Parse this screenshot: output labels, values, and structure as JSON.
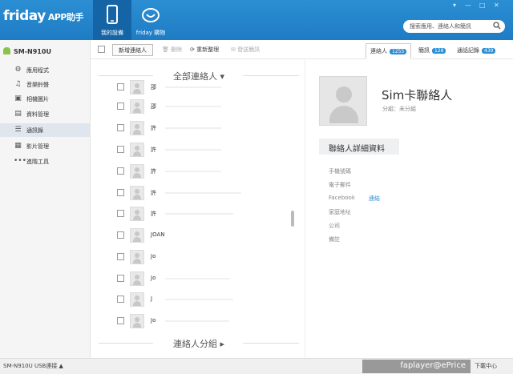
{
  "app": {
    "logo": "friday",
    "logo_sub": "APP助手"
  },
  "nav": [
    {
      "label": "我的設備",
      "icon": "phone-icon"
    },
    {
      "label": "friday 購物",
      "icon": "friday-shop-icon"
    }
  ],
  "window": {
    "menu": "▾",
    "minimize": "—",
    "maximize": "□",
    "close": "✕"
  },
  "search": {
    "placeholder": "搜索應用、連絡人和簡訊"
  },
  "sidebar": {
    "device": "SM-N910U",
    "items": [
      {
        "label": "應用程式",
        "icon": "gear-icon"
      },
      {
        "label": "音樂鈴聲",
        "icon": "music-icon"
      },
      {
        "label": "相機圖片",
        "icon": "image-icon"
      },
      {
        "label": "資料管理",
        "icon": "folder-icon"
      },
      {
        "label": "通訊錄",
        "icon": "contacts-icon"
      },
      {
        "label": "影片管理",
        "icon": "film-icon"
      },
      {
        "label": "進階工具",
        "icon": "more-icon"
      }
    ]
  },
  "toolbar": {
    "add": "新增連絡人",
    "delete": "刪除",
    "refresh": "重新整理",
    "send_sms": "發送簡訊"
  },
  "tabs": [
    {
      "label": "連絡人",
      "count": "1255"
    },
    {
      "label": "簡訊",
      "count": "128"
    },
    {
      "label": "通話記錄",
      "count": "439"
    }
  ],
  "contacts": {
    "group_all": "全部連絡人",
    "group_groups": "連絡人分組",
    "rows": [
      "邵",
      "許",
      "許",
      "許",
      "許",
      "許",
      "許",
      "JOAN",
      "Jo",
      "Jo",
      "J",
      "Jo",
      "Jo"
    ]
  },
  "detail": {
    "name": "Sim卡聯絡人",
    "group_label": "分組：",
    "group_value": "未分組",
    "section": "聯絡人詳細資料",
    "fields": [
      "手機號碼",
      "電子郵件",
      "Facebook",
      "家庭地址",
      "公司",
      "備註"
    ],
    "facebook_link": "連結"
  },
  "footer": {
    "status": "SM-N910U  USB連接  ▲",
    "watermark": "faplayer@ePrice",
    "download": "下載中心"
  }
}
